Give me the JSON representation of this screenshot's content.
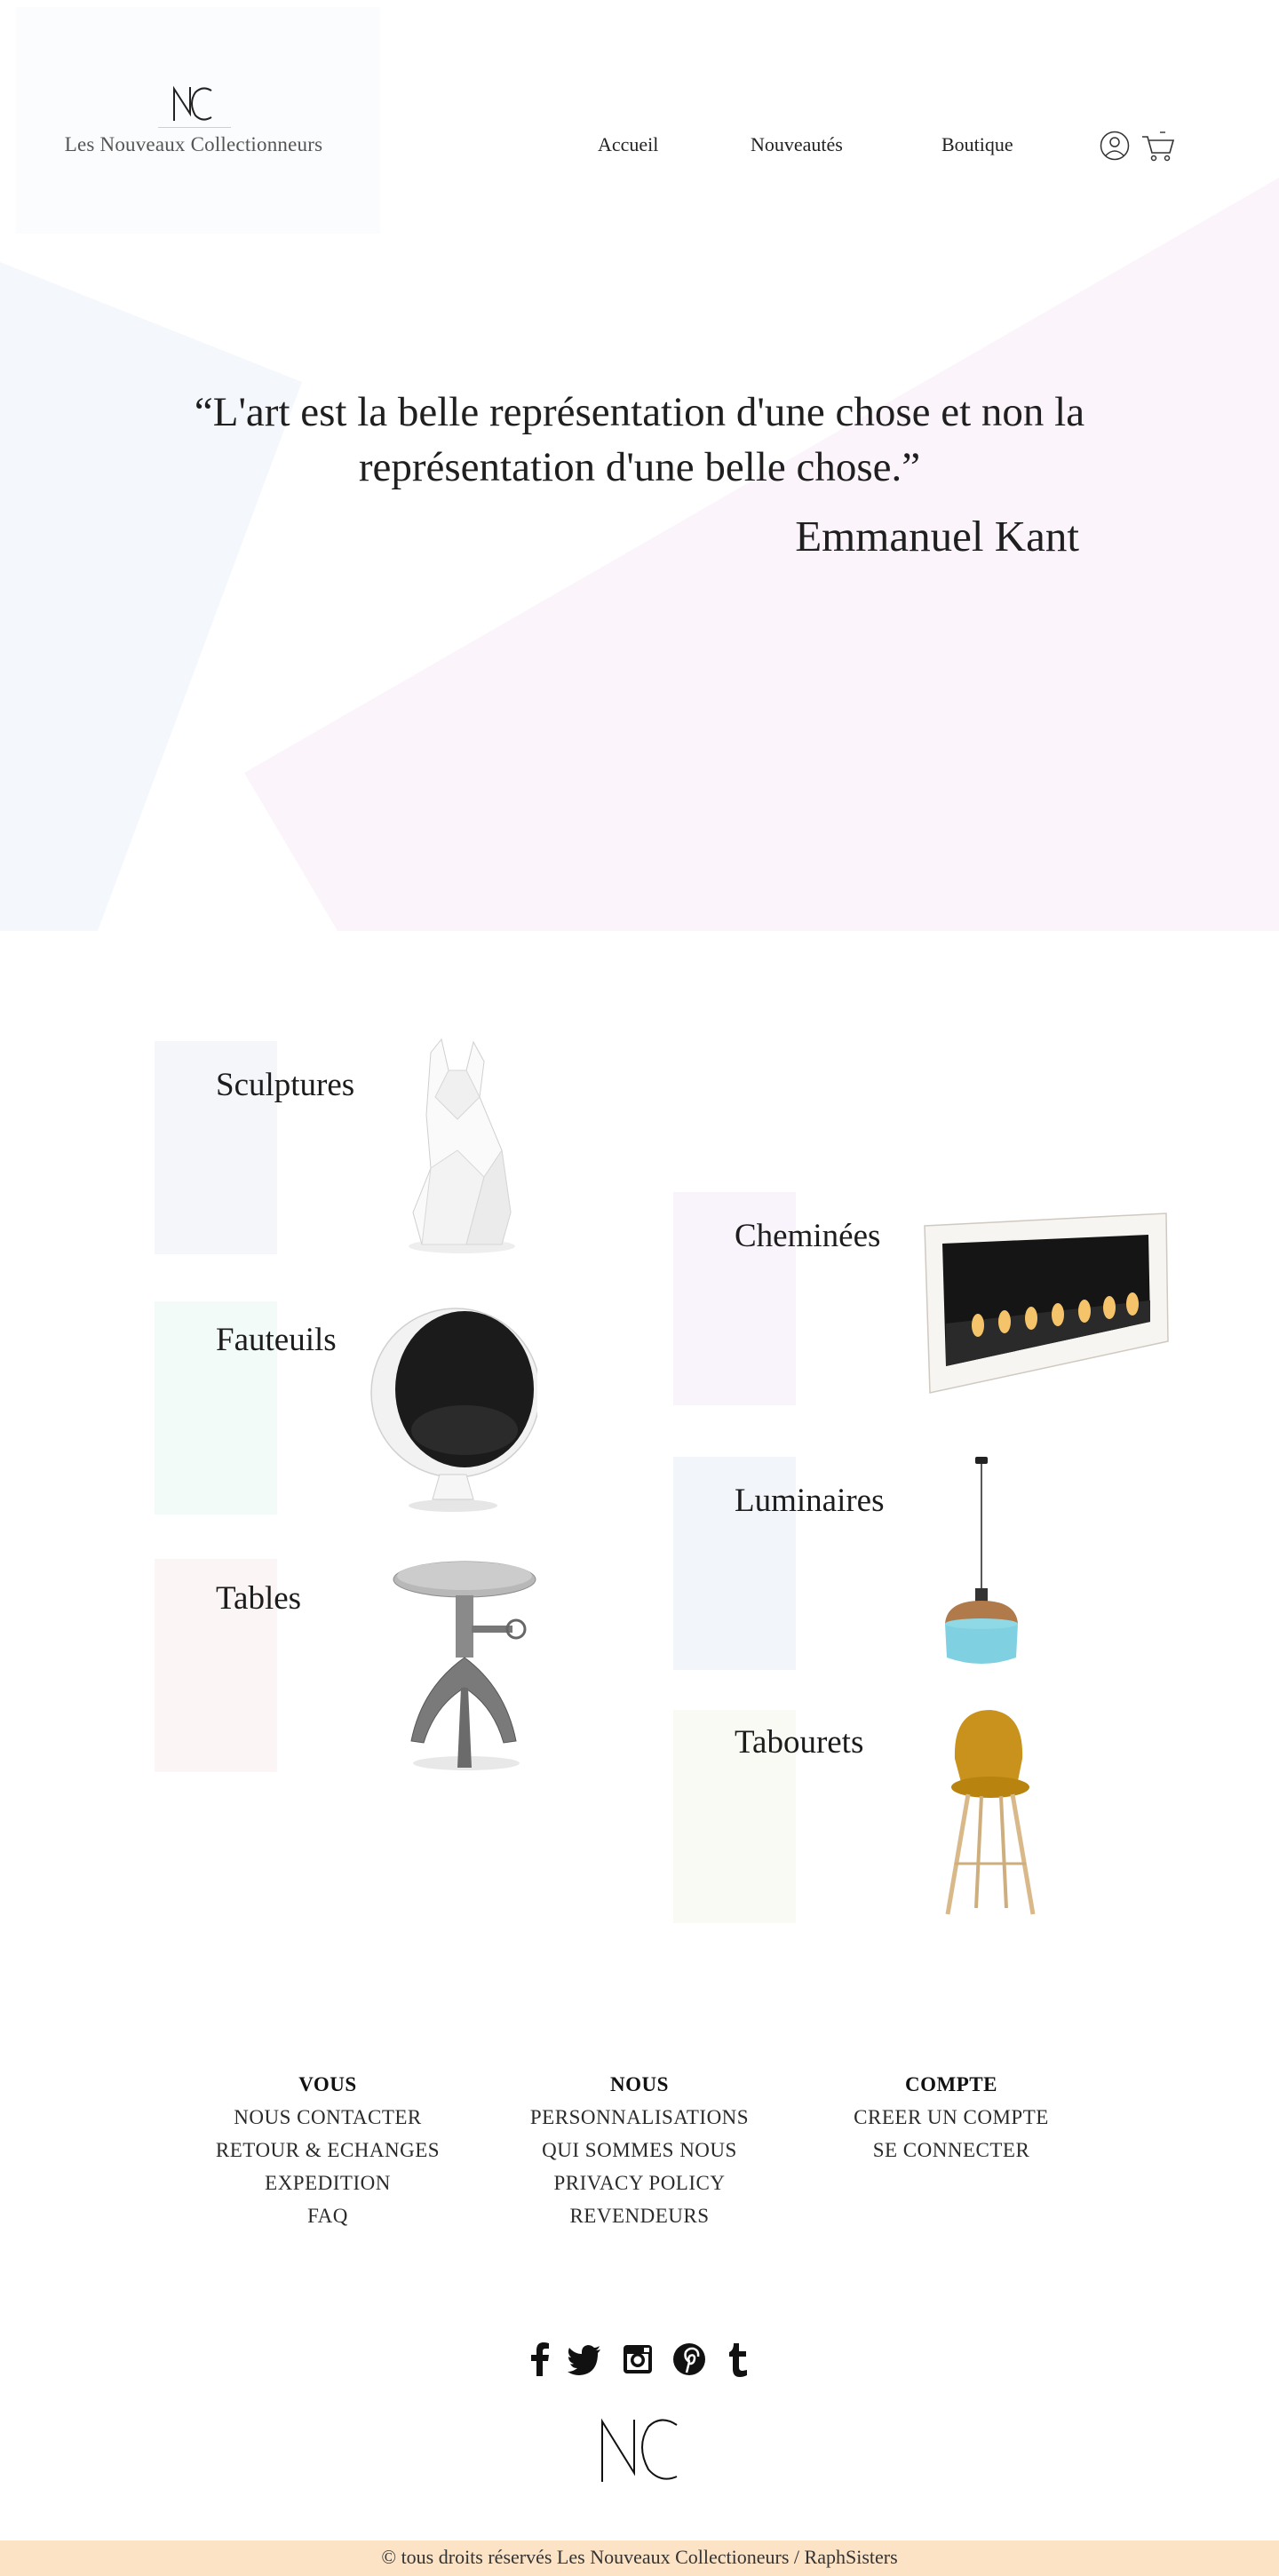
{
  "brand": {
    "name": "Les Nouveaux Collectionneurs",
    "logo_letters": "NC"
  },
  "nav": {
    "home": "Accueil",
    "new": "Nouveautés",
    "shop": "Boutique"
  },
  "hero": {
    "quote": "“L'art est la belle représentation d'une chose et non la représentation d'une belle chose.”",
    "author": "Emmanuel Kant"
  },
  "categories": [
    {
      "label": "Sculptures",
      "image": "origami-fox-sculpture",
      "accent": "#f4f6fa"
    },
    {
      "label": "Fauteuils",
      "image": "egg-ball-chair",
      "accent": "#f3fbf8"
    },
    {
      "label": "Tables",
      "image": "industrial-crank-table",
      "accent": "#fcf5f5"
    },
    {
      "label": "Cheminées",
      "image": "bioethanol-fireplace",
      "accent": "#f9f3fb"
    },
    {
      "label": "Luminaires",
      "image": "glass-pendant-lamp",
      "accent": "#f2f6fb"
    },
    {
      "label": "Tabourets",
      "image": "mustard-bar-stool",
      "accent": "#f9faf3"
    }
  ],
  "footer": {
    "vous": {
      "title": "VOUS",
      "links": [
        "NOUS CONTACTER",
        "RETOUR & ECHANGES",
        "EXPEDITION",
        "FAQ"
      ]
    },
    "nous": {
      "title": "NOUS",
      "links": [
        "PERSONNALISATIONS",
        "QUI SOMMES NOUS",
        "PRIVACY POLICY",
        "REVENDEURS"
      ]
    },
    "compte": {
      "title": "COMPTE",
      "links": [
        "CREER UN COMPTE",
        "SE CONNECTER"
      ]
    }
  },
  "social": [
    "facebook-icon",
    "twitter-icon",
    "instagram-icon",
    "pinterest-icon",
    "tumblr-icon"
  ],
  "copyright": "© tous droits réservés Les Nouveaux Collectioneurs / RaphSisters",
  "colors": {
    "footer_bar": "#fde3c6",
    "hero_pink": "#fbf4fb",
    "hero_blue": "#f4f7fb"
  }
}
